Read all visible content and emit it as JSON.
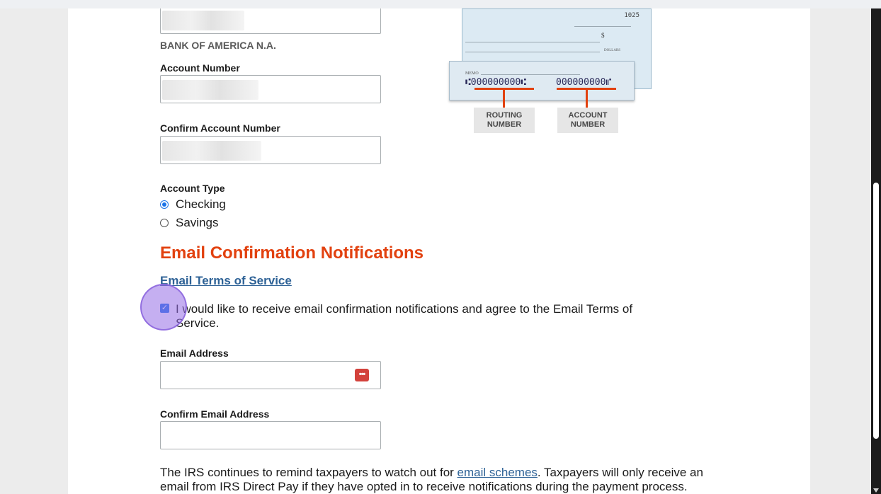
{
  "bank": {
    "name": "BANK OF AMERICA N.A."
  },
  "account_number": {
    "label": "Account Number",
    "value": ""
  },
  "confirm_account_number": {
    "label": "Confirm Account Number",
    "value": ""
  },
  "check_image": {
    "check_number": "1025",
    "memo_label": "MEMO",
    "dollar_sign": "$",
    "dollars_label": "DOLLARS",
    "routing_digits": "⑆000000000⑆",
    "account_digits": "000000000⑈",
    "routing_label_1": "ROUTING",
    "routing_label_2": "NUMBER",
    "account_label_1": "ACCOUNT",
    "account_label_2": "NUMBER",
    "accent_color": "#e2410f"
  },
  "account_type": {
    "label": "Account Type",
    "options": [
      {
        "label": "Checking",
        "selected": true
      },
      {
        "label": "Savings",
        "selected": false
      }
    ]
  },
  "email_section": {
    "title": "Email Confirmation Notifications",
    "terms_link": "Email Terms of Service",
    "consent_text": "I would like to receive email confirmation notifications and agree to the Email Terms of Service.",
    "consent_checked": true,
    "email_label": "Email Address",
    "email_value": "",
    "password_manager_icon": "password-manager-icon",
    "confirm_email_label": "Confirm Email Address",
    "confirm_email_value": ""
  },
  "footer": {
    "text_before_link": "The IRS continues to remind taxpayers to watch out for ",
    "link_text": "email schemes",
    "text_after_link": ". Taxpayers will only receive an email from IRS Direct Pay if they have opted in to receive notifications during the payment process."
  },
  "colors": {
    "heading": "#e2410f",
    "link": "#2e6296",
    "radio_checked": "#1a73e8"
  }
}
